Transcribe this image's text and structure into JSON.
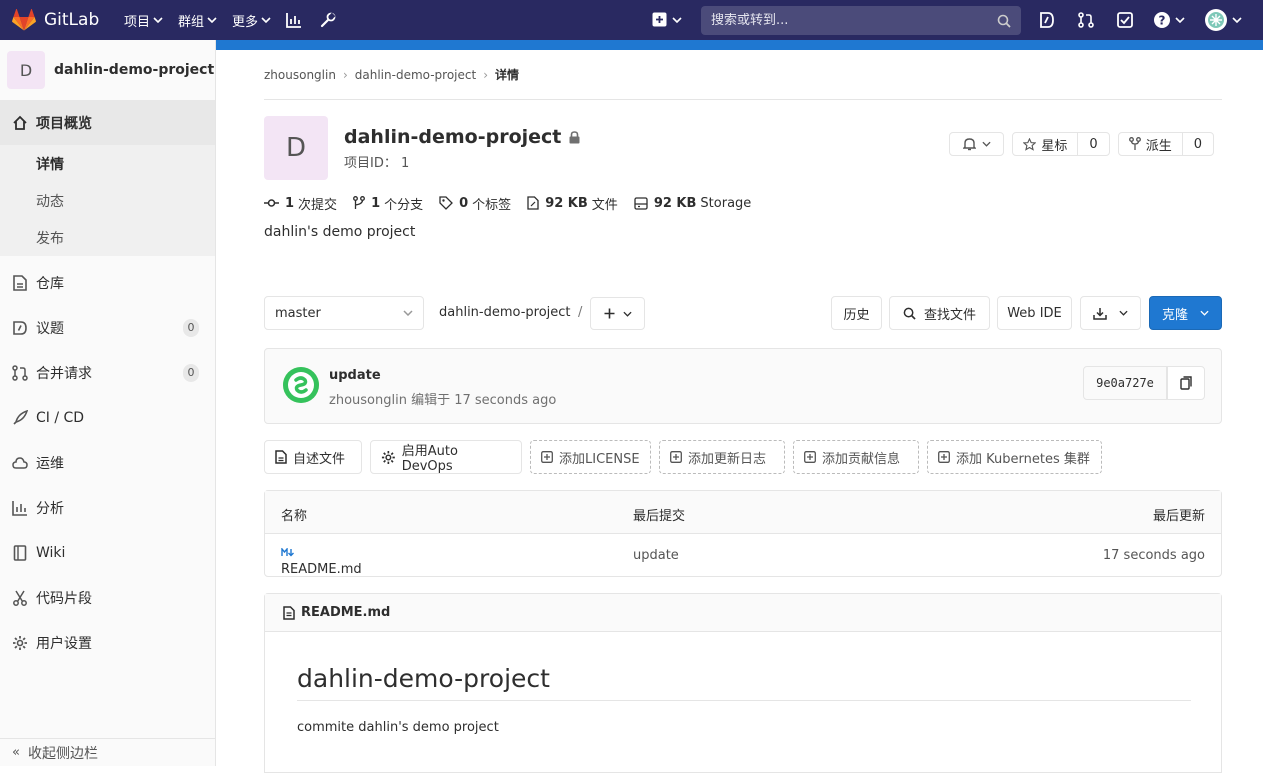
{
  "topbar": {
    "brand": "GitLab",
    "nav": [
      {
        "label": "项目"
      },
      {
        "label": "群组"
      },
      {
        "label": "更多"
      }
    ],
    "search_placeholder": "搜索或转到..."
  },
  "sidebar": {
    "project_initial": "D",
    "project_name": "dahlin-demo-project",
    "overview_label": "项目概览",
    "overview_sub": [
      "详情",
      "动态",
      "发布"
    ],
    "items": [
      {
        "label": "仓库",
        "icon": "doc-icon"
      },
      {
        "label": "议题",
        "icon": "issues-icon",
        "badge": "0"
      },
      {
        "label": "合并请求",
        "icon": "merge-request-icon",
        "badge": "0"
      },
      {
        "label": "CI / CD",
        "icon": "rocket-icon"
      },
      {
        "label": "运维",
        "icon": "cloud-icon"
      },
      {
        "label": "分析",
        "icon": "chart-icon"
      },
      {
        "label": "Wiki",
        "icon": "book-icon"
      },
      {
        "label": "代码片段",
        "icon": "scissors-icon"
      },
      {
        "label": "用户设置",
        "icon": "gear-icon"
      }
    ],
    "collapse_label": "收起侧边栏"
  },
  "breadcrumb": [
    "zhousonglin",
    "dahlin-demo-project",
    "详情"
  ],
  "project": {
    "initial": "D",
    "title": "dahlin-demo-project",
    "id_text": "项目ID： 1",
    "star_label": "星标",
    "star_count": "0",
    "fork_label": "派生",
    "fork_count": "0",
    "description": "dahlin's demo project"
  },
  "stats": [
    {
      "value": "1",
      "label": "次提交"
    },
    {
      "value": "1",
      "label": "个分支"
    },
    {
      "value": "0",
      "label": "个标签"
    },
    {
      "value": "92 KB",
      "label": "文件"
    },
    {
      "value": "92 KB",
      "label": "Storage"
    }
  ],
  "tree": {
    "branch": "master",
    "path": "dahlin-demo-project",
    "path_sep": "/",
    "history": "历史",
    "find_file": "查找文件",
    "web_ide": "Web IDE",
    "clone": "克隆"
  },
  "commit": {
    "title": "update",
    "meta": "zhousonglin 编辑于 17 seconds ago",
    "sha": "9e0a727e"
  },
  "quick_actions": [
    {
      "label": "自述文件",
      "style": "solid"
    },
    {
      "label": "启用Auto DevOps",
      "style": "solid"
    },
    {
      "label": "添加LICENSE",
      "style": "dashed"
    },
    {
      "label": "添加更新日志",
      "style": "dashed"
    },
    {
      "label": "添加贡献信息",
      "style": "dashed"
    },
    {
      "label": "添加 Kubernetes 集群",
      "style": "dashed"
    }
  ],
  "file_table": {
    "headers": [
      "名称",
      "最后提交",
      "最后更新"
    ],
    "rows": [
      {
        "name": "README.md",
        "commit": "update",
        "updated": "17 seconds ago"
      }
    ]
  },
  "readme": {
    "filename": "README.md",
    "heading": "dahlin-demo-project",
    "body": "commite dahlin's demo project"
  },
  "colors": {
    "topbar": "#292961",
    "accent": "#1f78d1",
    "avatar_bg": "#f3e5f5"
  }
}
